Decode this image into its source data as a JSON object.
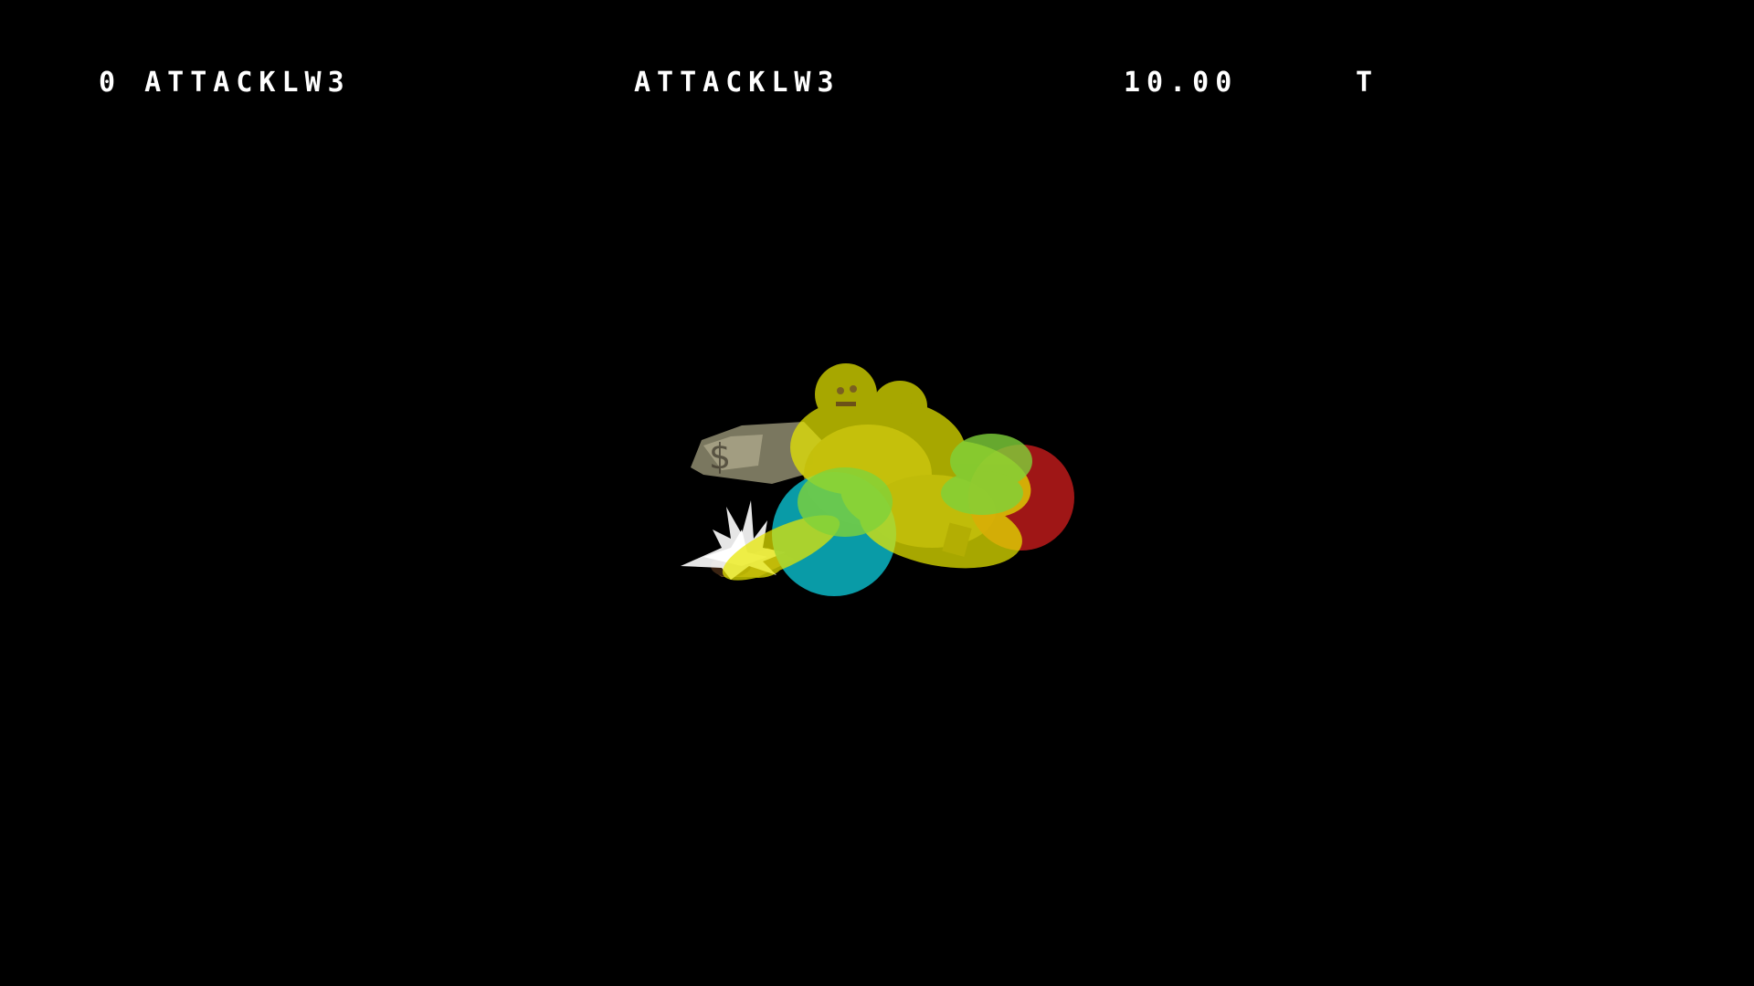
{
  "hud": {
    "frame_state": "0 ATTACKLW3",
    "move_name": "ATTACKLW3",
    "frame_count": "10.00",
    "flag": "T"
  },
  "colors": {
    "background": "#000000",
    "hud_text": "#ffffff",
    "hurtbox": "#e8e800",
    "hurtbox_overlap": "#7fd23a",
    "hitbox_red": "#b01818",
    "hitbox_cyan": "#0aa3b0",
    "hit_spark": "#ffffff"
  },
  "scene": {
    "character": "character-model",
    "hurtboxes": "yellow-capsules",
    "hitboxes": [
      "red-hitbox",
      "cyan-hitbox"
    ],
    "effect": "hit-spark"
  }
}
